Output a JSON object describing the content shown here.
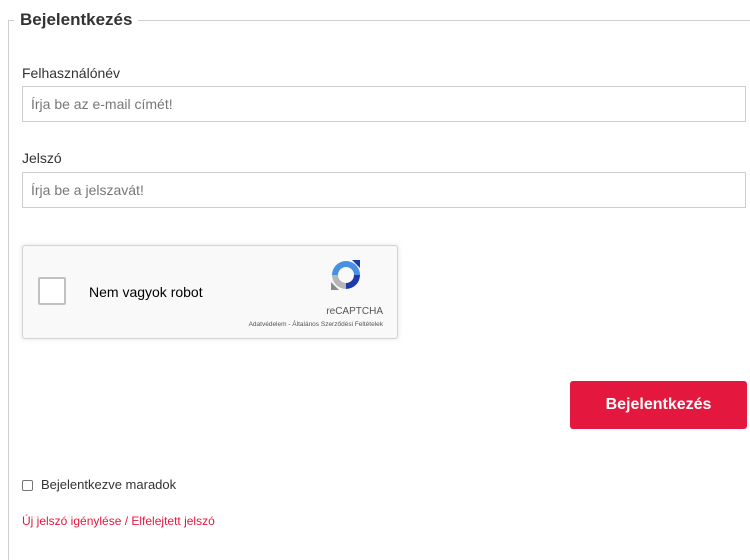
{
  "form": {
    "legend": "Bejelentkezés",
    "username": {
      "label": "Felhasználónév",
      "value": "",
      "placeholder": "Írja be az e-mail címét!"
    },
    "password": {
      "label": "Jelszó",
      "value": "",
      "placeholder": "Írja be a jelszavát!"
    },
    "captcha": {
      "label": "Nem vagyok robot",
      "brand": "reCAPTCHA",
      "links": "Adatvédelem - Általános Szerződési Feltételek",
      "icon": "recaptcha-logo-icon"
    },
    "submit_label": "Bejelentkezés",
    "remember_label": "Bejelentkezve maradok",
    "forgot_link": "Új jelszó igénylése / Elfelejtett jelszó"
  },
  "colors": {
    "accent": "#e4173e",
    "border": "#cccccc",
    "text": "#333333"
  }
}
